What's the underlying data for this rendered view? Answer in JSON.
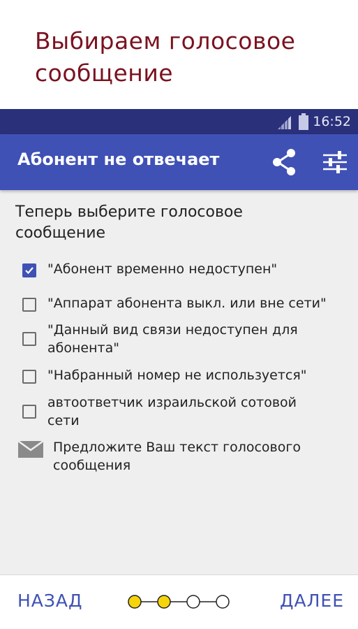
{
  "promo": {
    "title_line1": "Выбираем голосовое",
    "title_line2": "сообщение"
  },
  "status_bar": {
    "time": "16:52",
    "signal_icon": "signal-icon",
    "battery_icon": "battery-icon"
  },
  "app_bar": {
    "title": "Абонент не отвечает",
    "share_icon": "share-icon",
    "settings_icon": "sliders-icon",
    "background_color": "#3f51b5",
    "status_color": "#2a307a"
  },
  "content": {
    "instruction_line1": "Теперь выберите голосовое",
    "instruction_line2": "сообщение",
    "options": [
      {
        "line1": "\"Абонент временно недоступен\"",
        "line2": "",
        "checked": true
      },
      {
        "line1": "\"Аппарат абонента выкл. или вне сети\"",
        "line2": "",
        "checked": false
      },
      {
        "line1": "\"Данный вид связи недоступен для",
        "line2": "абонента\"",
        "checked": false
      },
      {
        "line1": "\"Набранный номер не используется\"",
        "line2": "",
        "checked": false
      },
      {
        "line1": "автоответчик израильской сотовой",
        "line2": "сети",
        "checked": false
      }
    ],
    "suggest": {
      "line1": "Предложите Ваш текст голосового",
      "line2": "сообщения",
      "icon": "envelope-icon"
    }
  },
  "bottom_bar": {
    "back_label": "НАЗАД",
    "next_label": "ДАЛЕЕ",
    "steps_total": 4,
    "steps_done": 2,
    "step_active_color": "#f5d40c",
    "accent_color": "#3f51b5"
  }
}
